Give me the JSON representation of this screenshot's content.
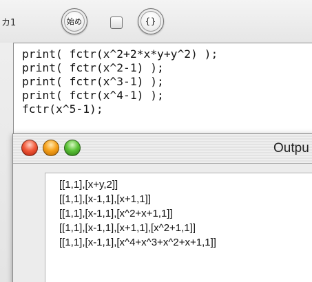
{
  "input_window": {
    "title": "カ1",
    "start_button_label": "始め",
    "braces_button_label": "{}",
    "code_lines": [
      "print( fctr(x^2+2*x*y+y^2) );",
      "print( fctr(x^2-1) );",
      "print( fctr(x^3-1) );",
      "print( fctr(x^4-1) );",
      "fctr(x^5-1);"
    ]
  },
  "output_window": {
    "title": "Outpu",
    "lines": [
      "[[1,1],[x+y,2]]",
      "[[1,1],[x-1,1],[x+1,1]]",
      "[[1,1],[x-1,1],[x^2+x+1,1]]",
      "[[1,1],[x-1,1],[x+1,1],[x^2+1,1]]",
      "[[1,1],[x-1,1],[x^4+x^3+x^2+x+1,1]]"
    ]
  },
  "colors": {
    "close": "#f25a3a",
    "minimize": "#f7a21c",
    "zoom": "#5cc338"
  }
}
